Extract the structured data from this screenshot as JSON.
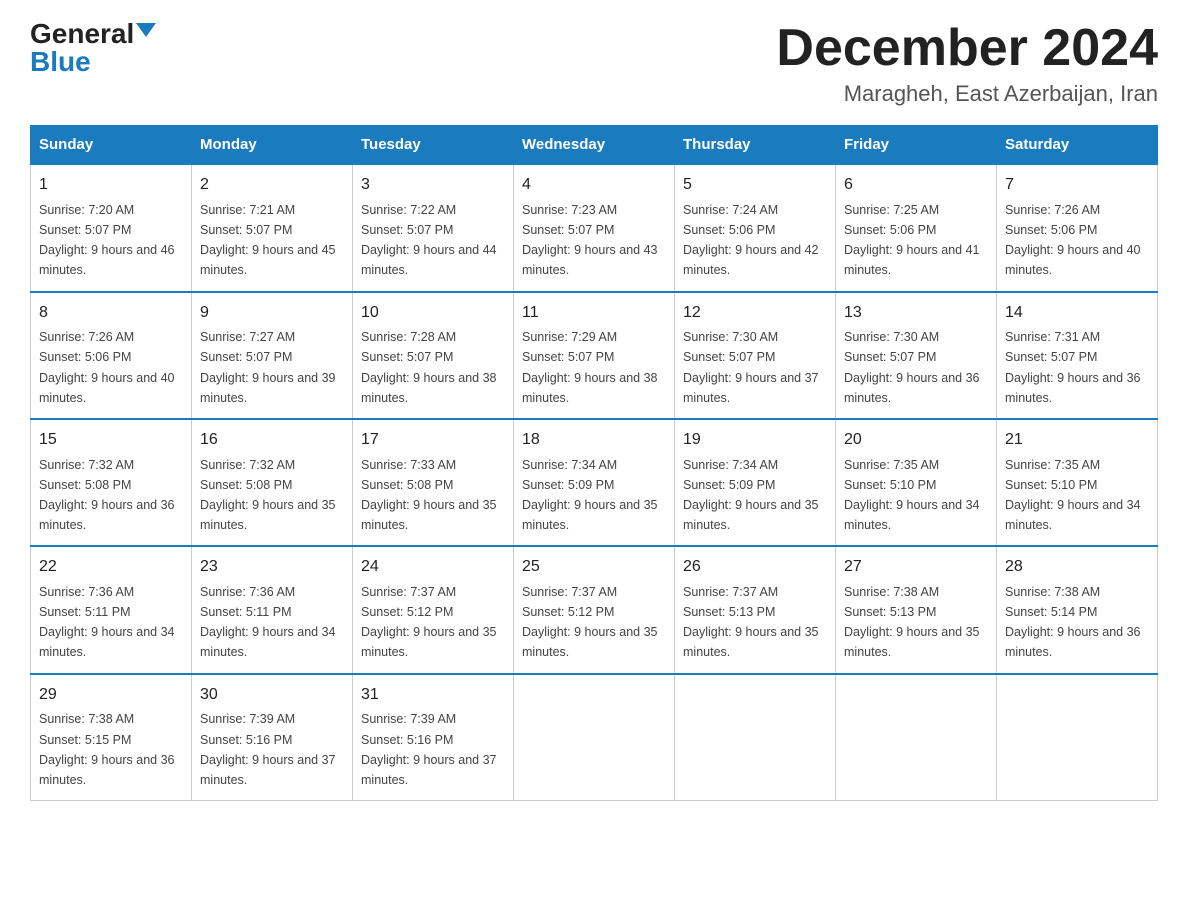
{
  "header": {
    "logo_general": "General",
    "logo_blue": "Blue",
    "main_title": "December 2024",
    "subtitle": "Maragheh, East Azerbaijan, Iran"
  },
  "days_of_week": [
    "Sunday",
    "Monday",
    "Tuesday",
    "Wednesday",
    "Thursday",
    "Friday",
    "Saturday"
  ],
  "weeks": [
    [
      {
        "day": "1",
        "sunrise": "7:20 AM",
        "sunset": "5:07 PM",
        "daylight": "9 hours and 46 minutes."
      },
      {
        "day": "2",
        "sunrise": "7:21 AM",
        "sunset": "5:07 PM",
        "daylight": "9 hours and 45 minutes."
      },
      {
        "day": "3",
        "sunrise": "7:22 AM",
        "sunset": "5:07 PM",
        "daylight": "9 hours and 44 minutes."
      },
      {
        "day": "4",
        "sunrise": "7:23 AM",
        "sunset": "5:07 PM",
        "daylight": "9 hours and 43 minutes."
      },
      {
        "day": "5",
        "sunrise": "7:24 AM",
        "sunset": "5:06 PM",
        "daylight": "9 hours and 42 minutes."
      },
      {
        "day": "6",
        "sunrise": "7:25 AM",
        "sunset": "5:06 PM",
        "daylight": "9 hours and 41 minutes."
      },
      {
        "day": "7",
        "sunrise": "7:26 AM",
        "sunset": "5:06 PM",
        "daylight": "9 hours and 40 minutes."
      }
    ],
    [
      {
        "day": "8",
        "sunrise": "7:26 AM",
        "sunset": "5:06 PM",
        "daylight": "9 hours and 40 minutes."
      },
      {
        "day": "9",
        "sunrise": "7:27 AM",
        "sunset": "5:07 PM",
        "daylight": "9 hours and 39 minutes."
      },
      {
        "day": "10",
        "sunrise": "7:28 AM",
        "sunset": "5:07 PM",
        "daylight": "9 hours and 38 minutes."
      },
      {
        "day": "11",
        "sunrise": "7:29 AM",
        "sunset": "5:07 PM",
        "daylight": "9 hours and 38 minutes."
      },
      {
        "day": "12",
        "sunrise": "7:30 AM",
        "sunset": "5:07 PM",
        "daylight": "9 hours and 37 minutes."
      },
      {
        "day": "13",
        "sunrise": "7:30 AM",
        "sunset": "5:07 PM",
        "daylight": "9 hours and 36 minutes."
      },
      {
        "day": "14",
        "sunrise": "7:31 AM",
        "sunset": "5:07 PM",
        "daylight": "9 hours and 36 minutes."
      }
    ],
    [
      {
        "day": "15",
        "sunrise": "7:32 AM",
        "sunset": "5:08 PM",
        "daylight": "9 hours and 36 minutes."
      },
      {
        "day": "16",
        "sunrise": "7:32 AM",
        "sunset": "5:08 PM",
        "daylight": "9 hours and 35 minutes."
      },
      {
        "day": "17",
        "sunrise": "7:33 AM",
        "sunset": "5:08 PM",
        "daylight": "9 hours and 35 minutes."
      },
      {
        "day": "18",
        "sunrise": "7:34 AM",
        "sunset": "5:09 PM",
        "daylight": "9 hours and 35 minutes."
      },
      {
        "day": "19",
        "sunrise": "7:34 AM",
        "sunset": "5:09 PM",
        "daylight": "9 hours and 35 minutes."
      },
      {
        "day": "20",
        "sunrise": "7:35 AM",
        "sunset": "5:10 PM",
        "daylight": "9 hours and 34 minutes."
      },
      {
        "day": "21",
        "sunrise": "7:35 AM",
        "sunset": "5:10 PM",
        "daylight": "9 hours and 34 minutes."
      }
    ],
    [
      {
        "day": "22",
        "sunrise": "7:36 AM",
        "sunset": "5:11 PM",
        "daylight": "9 hours and 34 minutes."
      },
      {
        "day": "23",
        "sunrise": "7:36 AM",
        "sunset": "5:11 PM",
        "daylight": "9 hours and 34 minutes."
      },
      {
        "day": "24",
        "sunrise": "7:37 AM",
        "sunset": "5:12 PM",
        "daylight": "9 hours and 35 minutes."
      },
      {
        "day": "25",
        "sunrise": "7:37 AM",
        "sunset": "5:12 PM",
        "daylight": "9 hours and 35 minutes."
      },
      {
        "day": "26",
        "sunrise": "7:37 AM",
        "sunset": "5:13 PM",
        "daylight": "9 hours and 35 minutes."
      },
      {
        "day": "27",
        "sunrise": "7:38 AM",
        "sunset": "5:13 PM",
        "daylight": "9 hours and 35 minutes."
      },
      {
        "day": "28",
        "sunrise": "7:38 AM",
        "sunset": "5:14 PM",
        "daylight": "9 hours and 36 minutes."
      }
    ],
    [
      {
        "day": "29",
        "sunrise": "7:38 AM",
        "sunset": "5:15 PM",
        "daylight": "9 hours and 36 minutes."
      },
      {
        "day": "30",
        "sunrise": "7:39 AM",
        "sunset": "5:16 PM",
        "daylight": "9 hours and 37 minutes."
      },
      {
        "day": "31",
        "sunrise": "7:39 AM",
        "sunset": "5:16 PM",
        "daylight": "9 hours and 37 minutes."
      },
      null,
      null,
      null,
      null
    ]
  ]
}
